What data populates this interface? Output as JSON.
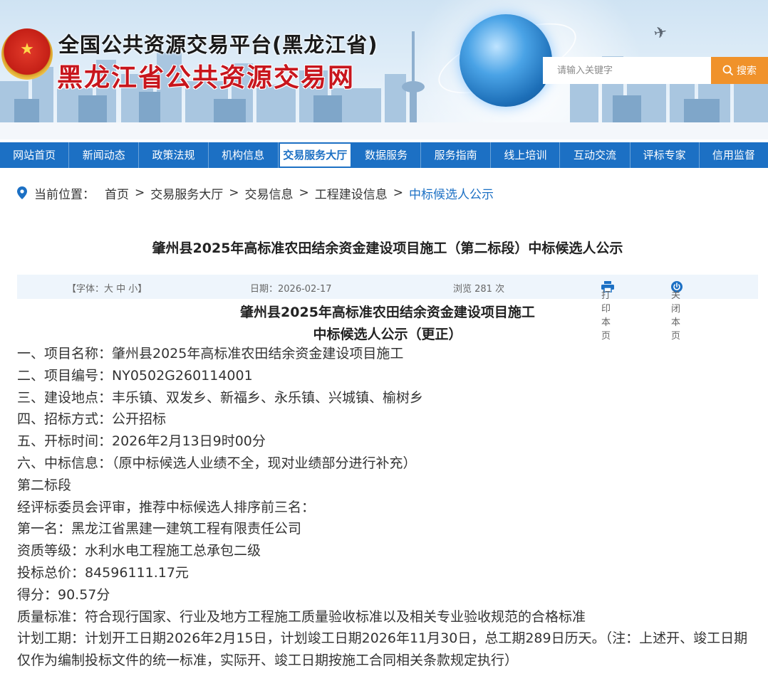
{
  "header": {
    "title_line1": "全国公共资源交易平台(黑龙江省)",
    "title_line2": "黑龙江省公共资源交易网",
    "search_placeholder": "请输入关键字",
    "search_button": "搜索"
  },
  "nav": {
    "items": [
      {
        "label": "网站首页"
      },
      {
        "label": "新闻动态"
      },
      {
        "label": "政策法规"
      },
      {
        "label": "机构信息"
      },
      {
        "label": "交易服务大厅"
      },
      {
        "label": "数据服务"
      },
      {
        "label": "服务指南"
      },
      {
        "label": "线上培训"
      },
      {
        "label": "互动交流"
      },
      {
        "label": "评标专家"
      },
      {
        "label": "信用监督"
      }
    ]
  },
  "breadcrumb": {
    "prefix": "当前位置：",
    "items": [
      "首页",
      "交易服务大厅",
      "交易信息",
      "工程建设信息",
      "中标候选人公示"
    ],
    "sep": ">"
  },
  "article": {
    "title": "肇州县2025年高标准农田结余资金建设项目施工（第二标段）中标候选人公示",
    "font_size_text": "【字体：大 中 小】",
    "date": "日期：2026-02-17",
    "views": "浏览 281 次",
    "print": "打印本页",
    "close": "关闭本页",
    "doc_title_1": "肇州县2025年高标准农田结余资金建设项目施工",
    "doc_title_2": "中标候选人公示（更正）",
    "lines": [
      "一、项目名称：肇州县2025年高标准农田结余资金建设项目施工",
      "二、项目编号：NY0502G260114001",
      "三、建设地点：丰乐镇、双发乡、新福乡、永乐镇、兴城镇、榆树乡",
      "四、招标方式：公开招标",
      "五、开标时间：2026年2月13日9时00分",
      "六、中标信息：（原中标候选人业绩不全，现对业绩部分进行补充）",
      "第二标段",
      "经评标委员会评审，推荐中标候选人排序前三名：",
      "第一名：黑龙江省黑建一建筑工程有限责任公司",
      "资质等级：水利水电工程施工总承包二级",
      "投标总价：84596111.17元",
      "得分：90.57分",
      "质量标准：符合现行国家、行业及地方工程施工质量验收标准以及相关专业验收规范的合格标准"
    ],
    "period_line": "计划工期：计划开工日期2026年2月15日，计划竣工日期2026年11月30日，总工期289日历天。（注：上述开、竣工日期仅作为编制投标文件的统一标准，实际开、竣工日期按施工合同相关条款规定执行）"
  },
  "colors": {
    "nav_bg": "#1c70c4",
    "search_btn": "#f0922b",
    "title_red": "#c8161d",
    "link_blue": "#1c70c4"
  }
}
